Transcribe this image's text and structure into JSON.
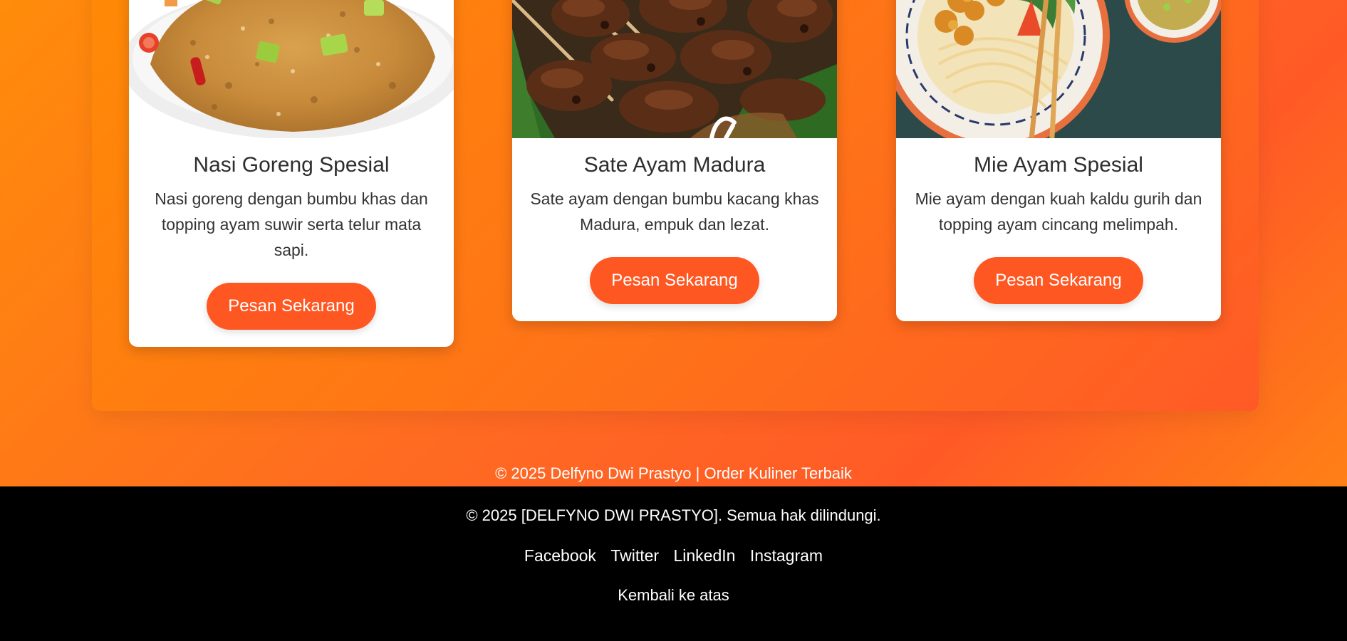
{
  "menu": {
    "items": [
      {
        "title": "Nasi Goreng Spesial",
        "description": "Nasi goreng dengan bumbu khas dan topping ayam suwir serta telur mata sapi.",
        "button_label": "Pesan Sekarang",
        "image_icon": "fried-rice-photo"
      },
      {
        "title": "Sate Ayam Madura",
        "description": "Sate ayam dengan bumbu kacang khas Madura, empuk dan lezat.",
        "button_label": "Pesan Sekarang",
        "image_icon": "chicken-satay-photo"
      },
      {
        "title": "Mie Ayam Spesial",
        "description": "Mie ayam dengan kuah kaldu gurih dan topping ayam cincang melimpah.",
        "button_label": "Pesan Sekarang",
        "image_icon": "chicken-noodle-photo"
      }
    ]
  },
  "page_footer": {
    "copyright": "© 2025 Delfyno Dwi Prastyo | Order Kuliner Terbaik"
  },
  "footer": {
    "copyright": "© 2025 [DELFYNO DWI PRASTYO]. Semua hak dilindungi.",
    "links": [
      "Facebook",
      "Twitter",
      "LinkedIn",
      "Instagram"
    ],
    "back_to_top": "Kembali ke atas"
  },
  "colors": {
    "accent": "#ff5722",
    "background_orange": "#ff7a1a",
    "footer_background": "#000000"
  }
}
